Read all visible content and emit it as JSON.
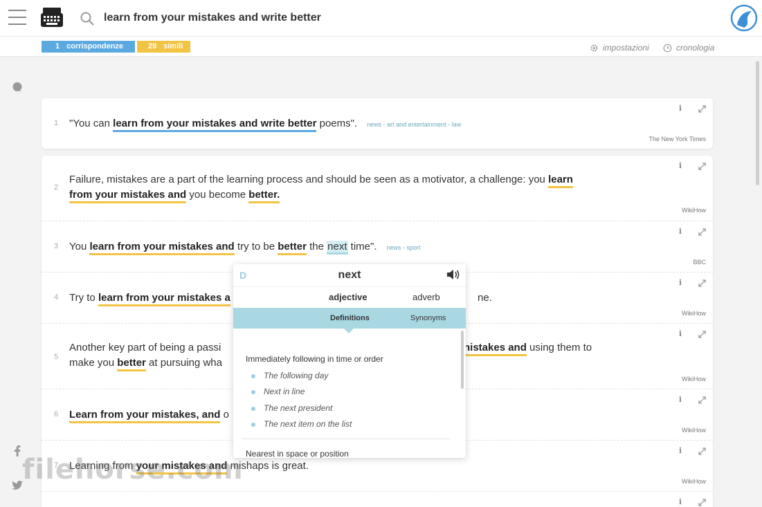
{
  "header": {
    "query": "learn from your mistakes and write better"
  },
  "subbar": {
    "matches_count": "1",
    "matches_label": "corrispondenze",
    "similar_count": "29",
    "similar_label": "simili",
    "settings_label": "impostazioni",
    "history_label": "cronologia"
  },
  "results": [
    {
      "num": "1",
      "pre": "\"You can ",
      "match": "learn from your mistakes and write better",
      "post": " poems\".",
      "tags": "news  -  art and entertainment  -  law",
      "source": "The New York Times"
    },
    {
      "num": "2",
      "line1_pre": "Failure, mistakes are a part of the learning process and should be seen as a motivator, a challenge: you ",
      "line1_match": "learn",
      "line2_match1": "from your mistakes and",
      "line2_mid": " you become ",
      "line2_match2": "better.",
      "source": "WikiHow"
    },
    {
      "num": "3",
      "pre": "You ",
      "match1": "learn from your mistakes and",
      "mid1": " try to be ",
      "match2": "better",
      "mid2": " the ",
      "highlight": "next",
      "post": " time\".",
      "tags": "news  -  sport",
      "source": "BBC"
    },
    {
      "num": "4",
      "pre": "Try to ",
      "match": "learn from your mistakes a",
      "post": "ne.",
      "source": "WikiHow"
    },
    {
      "num": "5",
      "line1_pre": "Another key part of being a passi",
      "line1_match": "nistakes and",
      "line1_post": " using them to",
      "line2_pre": "make you ",
      "line2_match": "better",
      "line2_post": " at pursuing wha",
      "source": "WikiHow"
    },
    {
      "num": "6",
      "match": "Learn from your mistakes, and",
      "post": " o",
      "source": "WikiHow"
    },
    {
      "num": "7",
      "pre": "Learning from ",
      "match": "your mistakes and",
      "post": " mishaps is great.",
      "source": "WikiHow"
    }
  ],
  "popup": {
    "dict_letter": "D",
    "word": "next",
    "pos_1": "adjective",
    "pos_2": "adverb",
    "tab_definitions": "Definitions",
    "tab_synonyms": "Synonyms",
    "sense_1": "Immediately following in time or order",
    "examples_1": [
      "The following day",
      "Next in line",
      "The next president",
      "The next item on the list"
    ],
    "sense_2": "Nearest in space or position"
  },
  "watermark": "filehorse.com",
  "colors": {
    "match_blue": "#5aa9e0",
    "similar_yellow": "#f3c343",
    "popup_tab_bg": "#a9d8e3"
  }
}
